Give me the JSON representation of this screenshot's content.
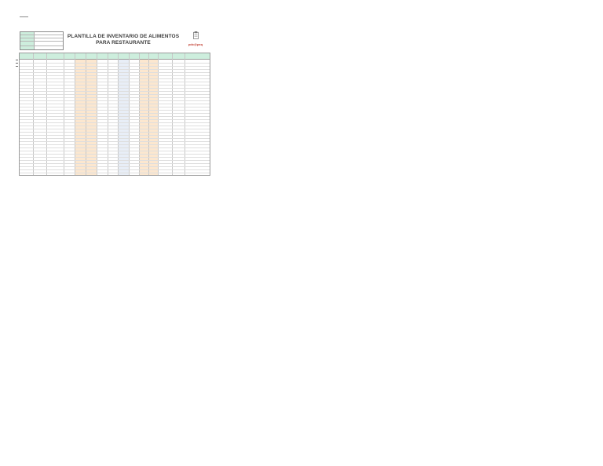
{
  "header": {
    "url": "",
    "title_line1": "PLANTILLA DE INVENTARIO DE ALIMENTOS",
    "title_line2": "PARA RESTAURANTE",
    "logo_text": "pdc@pxq"
  },
  "info": {
    "rows": [
      {
        "label": "",
        "value": ""
      },
      {
        "label": "",
        "value": ""
      },
      {
        "label": "",
        "value": ""
      },
      {
        "label": "",
        "value": ""
      },
      {
        "label": "",
        "value": ""
      }
    ]
  },
  "table": {
    "headers": [
      "",
      "",
      "",
      "",
      "",
      "",
      "",
      "",
      "",
      "",
      "",
      "",
      "",
      "",
      "",
      ""
    ],
    "rows": [
      [
        "",
        "",
        "",
        "",
        "",
        "",
        "",
        "",
        "",
        "",
        "",
        "",
        "",
        "",
        "",
        ""
      ],
      [
        "",
        "",
        "",
        "",
        "",
        "",
        "",
        "",
        "",
        "",
        "",
        "",
        "",
        "",
        "",
        ""
      ],
      [
        "",
        "",
        "",
        "",
        "",
        "",
        "",
        "",
        "",
        "",
        "",
        "",
        "",
        "",
        "",
        ""
      ]
    ]
  },
  "total": {
    "value": "",
    "sub": ""
  },
  "colors": {
    "header_green": "#cdeedd",
    "peach": "#fce7cf",
    "blue_col": "#e8eef7",
    "url_blue": "#1f2fbf",
    "logo_red": "#c0392b"
  }
}
